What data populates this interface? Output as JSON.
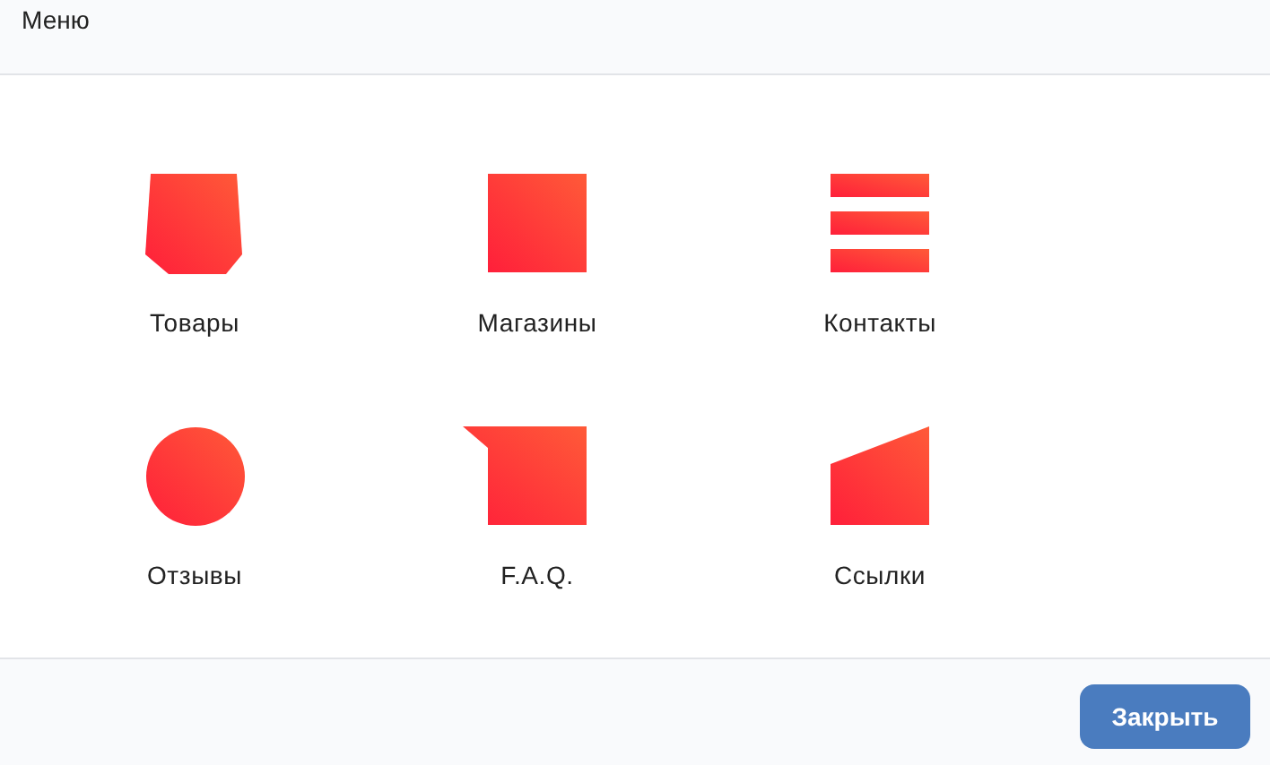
{
  "header": {
    "title": "Меню"
  },
  "menu_items": [
    {
      "label": "Товары",
      "kind": "pentagon"
    },
    {
      "label": "Магазины",
      "kind": "square"
    },
    {
      "label": "Контакты",
      "kind": "bars"
    },
    {
      "label": "Отзывы",
      "kind": "circle"
    },
    {
      "label": "F.A.Q.",
      "kind": "notch"
    },
    {
      "label": "Ссылки",
      "kind": "wedge"
    }
  ],
  "footer": {
    "close_button": "Закрыть"
  }
}
